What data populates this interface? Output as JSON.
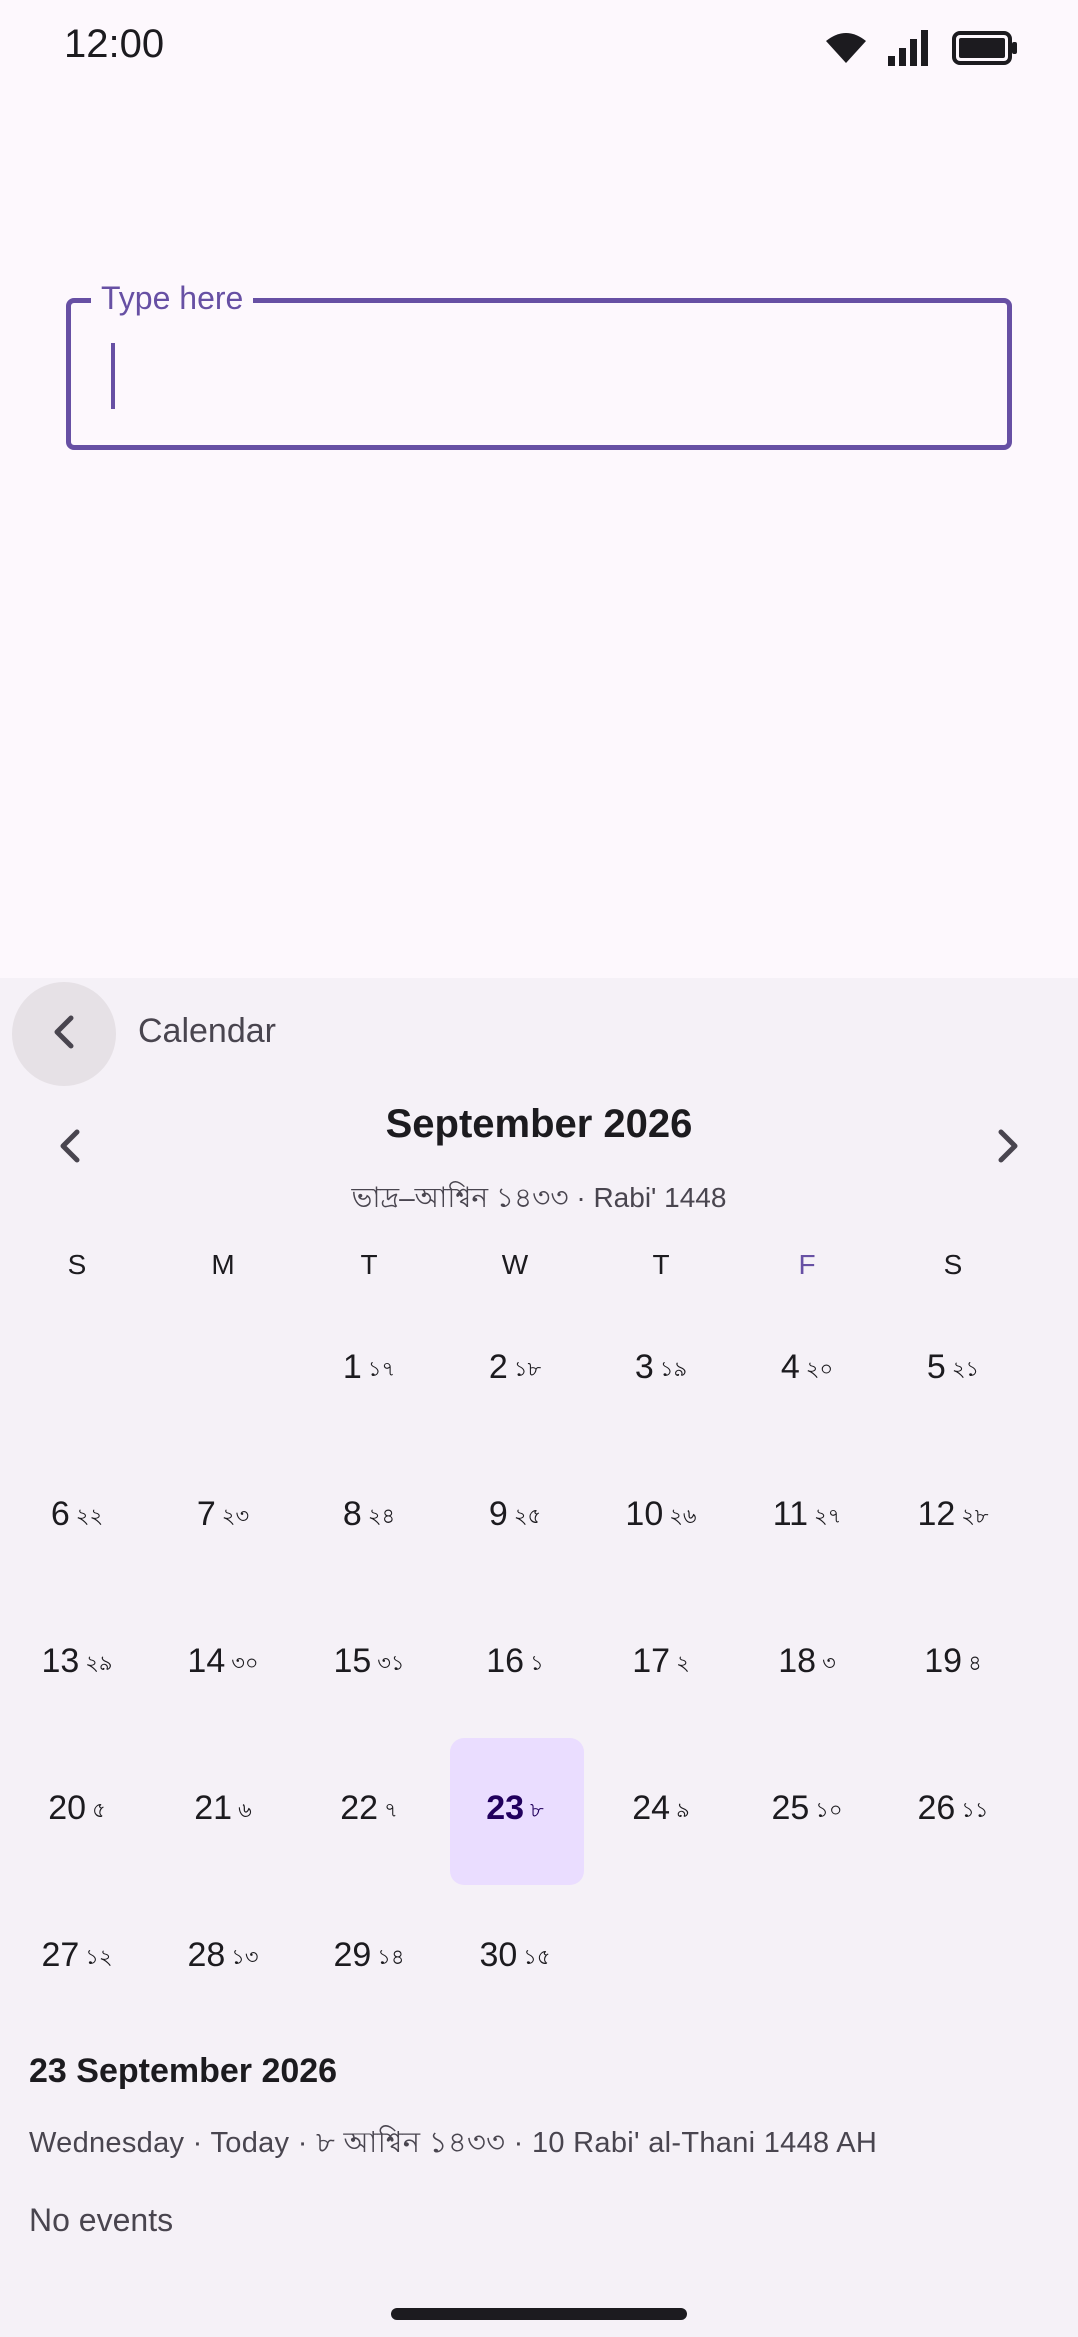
{
  "status_bar": {
    "time": "12:00",
    "icons": [
      "wifi-icon",
      "signal-icon",
      "battery-icon"
    ]
  },
  "text_field": {
    "label": "Type here",
    "value": ""
  },
  "calendar": {
    "header_title": "Calendar",
    "month_title": "September 2026",
    "month_subtitle": "ভাদ্র–আশ্বিন ১৪৩৩  ·  Rabi' 1448",
    "weekdays": [
      "S",
      "M",
      "T",
      "W",
      "T",
      "F",
      "S"
    ],
    "leading_blanks": 2,
    "days": [
      {
        "day": "1",
        "alt": "১৭"
      },
      {
        "day": "2",
        "alt": "১৮"
      },
      {
        "day": "3",
        "alt": "১৯"
      },
      {
        "day": "4",
        "alt": "২০"
      },
      {
        "day": "5",
        "alt": "২১"
      },
      {
        "day": "6",
        "alt": "২২"
      },
      {
        "day": "7",
        "alt": "২৩"
      },
      {
        "day": "8",
        "alt": "২৪"
      },
      {
        "day": "9",
        "alt": "২৫"
      },
      {
        "day": "10",
        "alt": "২৬"
      },
      {
        "day": "11",
        "alt": "২৭"
      },
      {
        "day": "12",
        "alt": "২৮"
      },
      {
        "day": "13",
        "alt": "২৯"
      },
      {
        "day": "14",
        "alt": "৩০"
      },
      {
        "day": "15",
        "alt": "৩১"
      },
      {
        "day": "16",
        "alt": "১"
      },
      {
        "day": "17",
        "alt": "২"
      },
      {
        "day": "18",
        "alt": "৩"
      },
      {
        "day": "19",
        "alt": "৪"
      },
      {
        "day": "20",
        "alt": "৫"
      },
      {
        "day": "21",
        "alt": "৬"
      },
      {
        "day": "22",
        "alt": "৭"
      },
      {
        "day": "23",
        "alt": "৮",
        "selected": true
      },
      {
        "day": "24",
        "alt": "৯"
      },
      {
        "day": "25",
        "alt": "১০"
      },
      {
        "day": "26",
        "alt": "১১"
      },
      {
        "day": "27",
        "alt": "১২"
      },
      {
        "day": "28",
        "alt": "১৩"
      },
      {
        "day": "29",
        "alt": "১৪"
      },
      {
        "day": "30",
        "alt": "১৫"
      }
    ],
    "selected_date": "23 September 2026",
    "selected_info": "Wednesday · Today · ৮ আশ্বিন ১৪৩৩ · 10 Rabi' al-Thani 1448 AH",
    "events_text": "No events"
  },
  "colors": {
    "accent": "#6750a4",
    "selected_bg": "#eaddff",
    "sheet_bg": "#f5f1f7",
    "page_bg": "#fdf8fd"
  }
}
